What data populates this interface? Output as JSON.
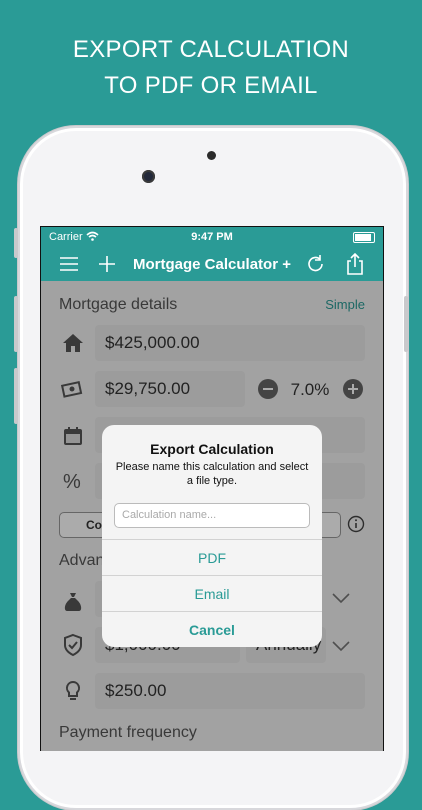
{
  "promo": {
    "line1": "EXPORT CALCULATION",
    "line2": "TO PDF OR EMAIL"
  },
  "status": {
    "carrier": "Carrier",
    "time": "9:47 PM"
  },
  "nav": {
    "title": "Mortgage Calculator +"
  },
  "mortgage": {
    "section_title": "Mortgage details",
    "mode_link": "Simple",
    "home_price": "$425,000.00",
    "down_payment": "$29,750.00",
    "down_percent": "7.0%",
    "compute_button_partial": "Co"
  },
  "advanced": {
    "section_partial": "Advan",
    "insurance_value": "$1,000.00",
    "insurance_period": "Annually",
    "utilities_value": "$250.00"
  },
  "payment_frequency_title": "Payment frequency",
  "dialog": {
    "title": "Export Calculation",
    "message": "Please name this calculation and select a file type.",
    "input_placeholder": "Calculation name...",
    "pdf": "PDF",
    "email": "Email",
    "cancel": "Cancel"
  },
  "colors": {
    "accent": "#2a9b96"
  }
}
